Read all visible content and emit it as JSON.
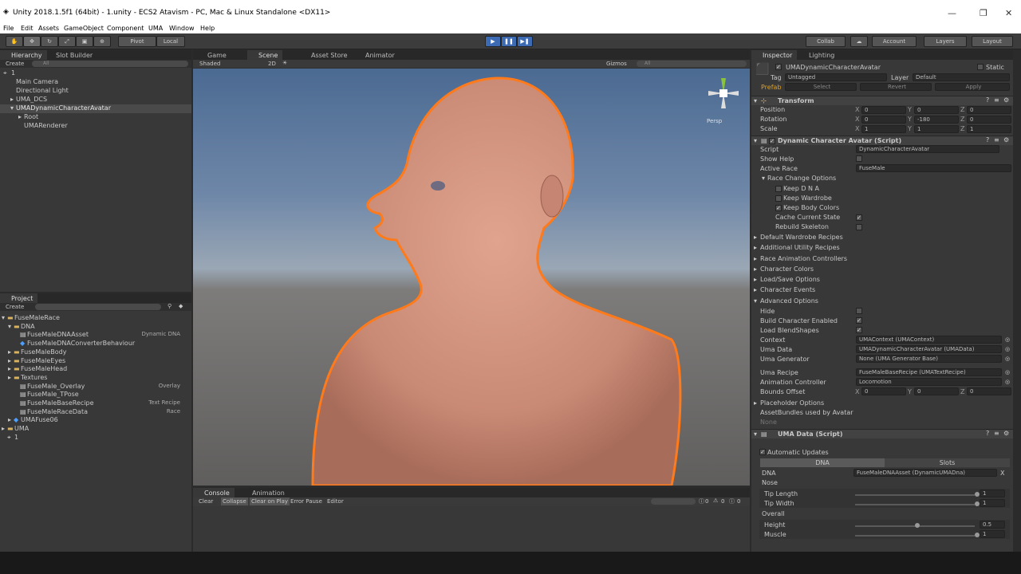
{
  "window": {
    "title": "Unity 2018.1.5f1 (64bit) - 1.unity - ECS2 Atavism - PC, Mac & Linux Standalone <DX11>"
  },
  "menu": [
    "File",
    "Edit",
    "Assets",
    "GameObject",
    "Component",
    "UMA",
    "Window",
    "Help"
  ],
  "toolbar": {
    "pivot": "Pivot",
    "local": "Local",
    "collab": "Collab",
    "account": "Account",
    "layers": "Layers",
    "layout": "Layout"
  },
  "hierarchy": {
    "tabs": [
      "Hierarchy",
      "Slot Builder"
    ],
    "create": "Create",
    "search": "All",
    "scene": "1",
    "items": [
      "Main Camera",
      "Directional Light",
      "UMA_DCS",
      "UMADynamicCharacterAvatar",
      "Root",
      "UMARenderer"
    ]
  },
  "scene_tabs": [
    "Game",
    "Scene",
    "Asset Store",
    "Animator"
  ],
  "scene_bar": {
    "shaded": "Shaded",
    "mode2d": "2D",
    "gizmos": "Gizmos",
    "search": "All",
    "persp": "Persp"
  },
  "project": {
    "tab": "Project",
    "create": "Create",
    "items": [
      {
        "label": "FuseMaleRace",
        "type": ""
      },
      {
        "label": "DNA",
        "type": ""
      },
      {
        "label": "FuseMaleDNAAsset",
        "type": "Dynamic DNA"
      },
      {
        "label": "FuseMaleDNAConverterBehaviour",
        "type": ""
      },
      {
        "label": "FuseMaleBody",
        "type": ""
      },
      {
        "label": "FuseMaleEyes",
        "type": ""
      },
      {
        "label": "FuseMaleHead",
        "type": ""
      },
      {
        "label": "Textures",
        "type": ""
      },
      {
        "label": "FuseMale_Overlay",
        "type": "Overlay"
      },
      {
        "label": "FuseMale_TPose",
        "type": ""
      },
      {
        "label": "FuseMaleBaseRecipe",
        "type": "Text Recipe"
      },
      {
        "label": "FuseMaleRaceData",
        "type": "Race"
      },
      {
        "label": "UMAFuse06",
        "type": ""
      },
      {
        "label": "UMA",
        "type": ""
      },
      {
        "label": "1",
        "type": ""
      }
    ]
  },
  "console": {
    "tabs": [
      "Console",
      "Animation"
    ],
    "buttons": [
      "Clear",
      "Collapse",
      "Clear on Play",
      "Error Pause",
      "Editor"
    ],
    "counts": [
      "0",
      "0",
      "0"
    ]
  },
  "inspector": {
    "tabs": [
      "Inspector",
      "Lighting"
    ],
    "object_name": "UMADynamicCharacterAvatar",
    "static": "Static",
    "tag_label": "Tag",
    "tag": "Untagged",
    "layer_label": "Layer",
    "layer": "Default",
    "prefab": "Prefab",
    "select": "Select",
    "revert": "Revert",
    "apply": "Apply",
    "transform": {
      "title": "Transform",
      "position": "Position",
      "rotation": "Rotation",
      "scale": "Scale",
      "pos": [
        "0",
        "0",
        "0"
      ],
      "rot": [
        "0",
        "-180",
        "0"
      ],
      "scl": [
        "1",
        "1",
        "1"
      ]
    },
    "dca": {
      "title": "Dynamic Character Avatar (Script)",
      "script_label": "Script",
      "script": "DynamicCharacterAvatar",
      "show_help": "Show Help",
      "active_race": "Active Race",
      "race": "FuseMale",
      "race_change": "Race Change Options",
      "keep_dna": "Keep D N A",
      "keep_wardrobe": "Keep Wardrobe",
      "keep_body_colors": "Keep Body Colors",
      "cache_state": "Cache Current State",
      "rebuild_skeleton": "Rebuild Skeleton",
      "foldouts": [
        "Default Wardrobe Recipes",
        "Additional Utility Recipes",
        "Race Animation Controllers",
        "Character Colors",
        "Load/Save Options",
        "Character Events",
        "Advanced Options"
      ],
      "hide": "Hide",
      "build_enabled": "Build Character Enabled",
      "load_blend": "Load BlendShapes",
      "context_label": "Context",
      "context": "UMAContext (UMAContext)",
      "umadata_label": "Uma Data",
      "umadata": "UMADynamicCharacterAvatar (UMAData)",
      "generator_label": "Uma Generator",
      "generator": "None (UMA Generator Base)",
      "recipe_label": "Uma Recipe",
      "recipe": "FuseMaleBaseRecipe (UMATextRecipe)",
      "anim_label": "Animation Controller",
      "anim": "Locomotion",
      "bounds_label": "Bounds Offset",
      "bounds": [
        "0",
        "0",
        "0"
      ],
      "placeholder": "Placeholder Options",
      "bundles": "AssetBundles used by Avatar",
      "none": "None"
    },
    "umadata": {
      "title": "UMA Data (Script)",
      "auto": "Automatic Updates",
      "tab_dna": "DNA",
      "tab_slots": "Slots",
      "dna_label": "DNA",
      "dna": "FuseMaleDNAAsset (DynamicUMADna)",
      "x": "X",
      "nose": "Nose",
      "tip_length": "Tip Length",
      "tip_length_v": "1",
      "tip_width": "Tip Width",
      "tip_width_v": "1",
      "overall": "Overall",
      "height": "Height",
      "height_v": "0.5",
      "muscle": "Muscle",
      "muscle_v": "1"
    }
  },
  "colors": {
    "accent": "#3d6bb3",
    "selection_outline": "#ff7a1a"
  }
}
